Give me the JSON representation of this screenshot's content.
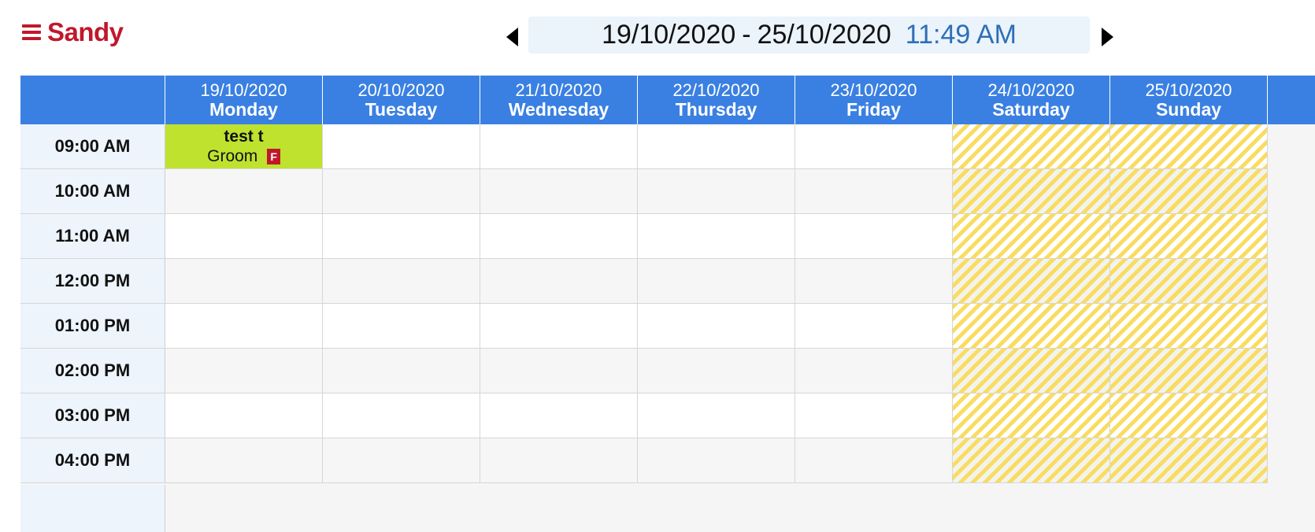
{
  "header": {
    "user_name": "Sandy",
    "date_range_start": "19/10/2020",
    "date_range_separator": "-",
    "date_range_end": "25/10/2020",
    "current_time": "11:49 AM",
    "icons": {
      "menu": "hamburger-icon",
      "prev": "triangle-left-icon",
      "next": "triangle-right-icon"
    }
  },
  "calendar": {
    "days": [
      {
        "date": "19/10/2020",
        "name": "Monday"
      },
      {
        "date": "20/10/2020",
        "name": "Tuesday"
      },
      {
        "date": "21/10/2020",
        "name": "Wednesday"
      },
      {
        "date": "22/10/2020",
        "name": "Thursday"
      },
      {
        "date": "23/10/2020",
        "name": "Friday"
      },
      {
        "date": "24/10/2020",
        "name": "Saturday"
      },
      {
        "date": "25/10/2020",
        "name": "Sunday"
      }
    ],
    "times": [
      "09:00 AM",
      "10:00 AM",
      "11:00 AM",
      "12:00 PM",
      "01:00 PM",
      "02:00 PM",
      "03:00 PM",
      "04:00 PM"
    ],
    "weekend_days": [
      "Saturday",
      "Sunday"
    ],
    "event": {
      "title": "test t",
      "service": "Groom",
      "badge": "F",
      "day": "Monday",
      "time": "09:00 AM"
    }
  },
  "colors": {
    "brand": "#c0182b",
    "header_bar": "#3a80e2",
    "time_text": "#2d6fb6",
    "event_bg": "#bfe22f",
    "weekend_stripe": "#f9dc60"
  }
}
